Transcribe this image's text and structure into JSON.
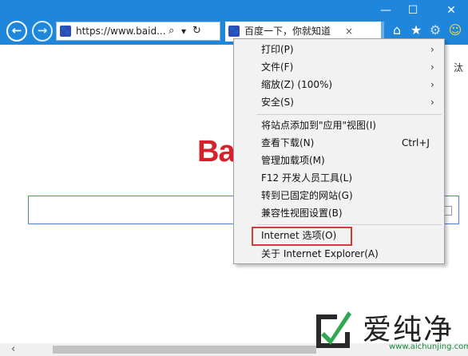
{
  "window": {
    "minimize_glyph": "—",
    "maximize_glyph": "☐",
    "close_glyph": "✕"
  },
  "nav": {
    "back_glyph": "←",
    "forward_glyph": "→"
  },
  "address_bar": {
    "url": "https://www.baid...",
    "search_glyph": "⌕",
    "dropdown_glyph": "▾",
    "refresh_glyph": "↻"
  },
  "tab": {
    "title": "百度一下，你就知道",
    "close_glyph": "×"
  },
  "toolbar_icons": {
    "home": "⌂",
    "favorites": "★",
    "tools": "⚙",
    "smiley": "☺"
  },
  "page": {
    "logo_text": "Ba",
    "cut_text": "汰"
  },
  "menu": {
    "items": [
      {
        "label": "打印(P)",
        "submenu": true
      },
      {
        "label": "文件(F)",
        "submenu": true
      },
      {
        "label": "缩放(Z) (100%)",
        "submenu": true
      },
      {
        "label": "安全(S)",
        "submenu": true
      },
      {
        "label": "将站点添加到\"应用\"视图(I)"
      },
      {
        "label": "查看下载(N)",
        "shortcut": "Ctrl+J"
      },
      {
        "label": "管理加载项(M)"
      },
      {
        "label": "F12 开发人员工具(L)"
      },
      {
        "label": "转到已固定的网站(G)"
      },
      {
        "label": "兼容性视图设置(B)"
      },
      {
        "label": "Internet 选项(O)",
        "highlighted": true
      },
      {
        "label": "关于 Internet Explorer(A)"
      }
    ],
    "submenu_arrow": "›"
  },
  "watermark": {
    "brand": "爱纯净",
    "url": "www.aichunjing.com"
  },
  "colors": {
    "titlebar": "#1e86db",
    "highlight_border": "#d43c3c",
    "logo_red": "#d8202a"
  }
}
